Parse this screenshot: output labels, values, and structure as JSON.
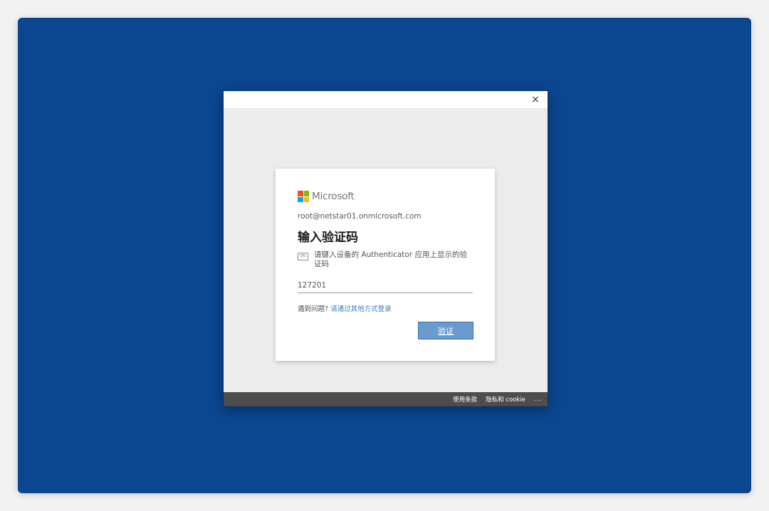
{
  "dialog": {
    "close_label": "×"
  },
  "signin": {
    "brand": "Microsoft",
    "logo_colors": [
      "#f25022",
      "#7fba00",
      "#00a4ef",
      "#ffb900"
    ],
    "account": "root@netstar01.onmicrosoft.com",
    "title": "输入验证码",
    "instruction_icon": "sms-icon",
    "instruction_icon_text": "SMS",
    "instruction": "请键入设备的 Authenticator 应用上显示的验证码",
    "code_value": "127201",
    "help_prefix": "遇到问题?",
    "help_link": "请通过其他方式登录",
    "verify_label": "验证"
  },
  "footer": {
    "terms": "使用条款",
    "privacy": "隐私和 cookie",
    "more": "..."
  },
  "colors": {
    "desktop_bg": "#0b4690",
    "button_bg": "#6a9bd0",
    "link": "#2e7cd6",
    "footer_bg": "#4d4d4d"
  }
}
